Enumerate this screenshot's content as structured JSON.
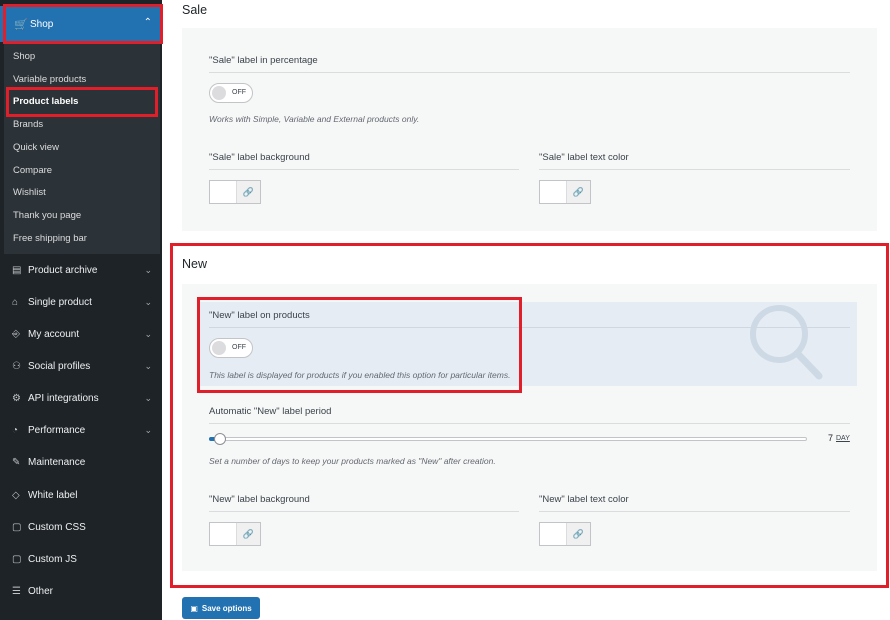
{
  "sidebar": {
    "shop_label": "Shop",
    "submenu": [
      {
        "label": "Shop",
        "active": false
      },
      {
        "label": "Variable products",
        "active": false
      },
      {
        "label": "Product labels",
        "active": true
      },
      {
        "label": "Brands",
        "active": false
      },
      {
        "label": "Quick view",
        "active": false
      },
      {
        "label": "Compare",
        "active": false
      },
      {
        "label": "Wishlist",
        "active": false
      },
      {
        "label": "Thank you page",
        "active": false
      },
      {
        "label": "Free shipping bar",
        "active": false
      }
    ],
    "menu": [
      {
        "label": "Product archive",
        "icon": "archive-icon"
      },
      {
        "label": "Single product",
        "icon": "bag-icon"
      },
      {
        "label": "My account",
        "icon": "account-icon"
      },
      {
        "label": "Social profiles",
        "icon": "users-icon"
      },
      {
        "label": "API integrations",
        "icon": "gear-icon"
      },
      {
        "label": "Performance",
        "icon": "dashboard-icon"
      },
      {
        "label": "Maintenance",
        "icon": "wrench-icon"
      },
      {
        "label": "White label",
        "icon": "tag-icon"
      },
      {
        "label": "Custom CSS",
        "icon": "css-file-icon"
      },
      {
        "label": "Custom JS",
        "icon": "js-file-icon"
      },
      {
        "label": "Other",
        "icon": "list-icon"
      }
    ]
  },
  "sale": {
    "title": "Sale",
    "percentage_label": "\"Sale\" label in percentage",
    "percentage_toggle": "OFF",
    "percentage_hint": "Works with Simple, Variable and External products only.",
    "background_label": "\"Sale\" label background",
    "text_color_label": "\"Sale\" label text color"
  },
  "new": {
    "title": "New",
    "on_products_label": "\"New\" label on products",
    "on_products_toggle": "OFF",
    "on_products_hint": "This label is displayed for products if you enabled this option for particular items.",
    "period_label": "Automatic \"New\" label period",
    "period_value": "7",
    "period_unit": "DAY",
    "period_hint": "Set a number of days to keep your products marked as \"New\" after creation.",
    "background_label": "\"New\" label background",
    "text_color_label": "\"New\" label text color"
  },
  "save_label": "Save options",
  "colors": {
    "accent": "#2271b1",
    "sidebar": "#1d2327",
    "highlight": "#e01f2a"
  }
}
